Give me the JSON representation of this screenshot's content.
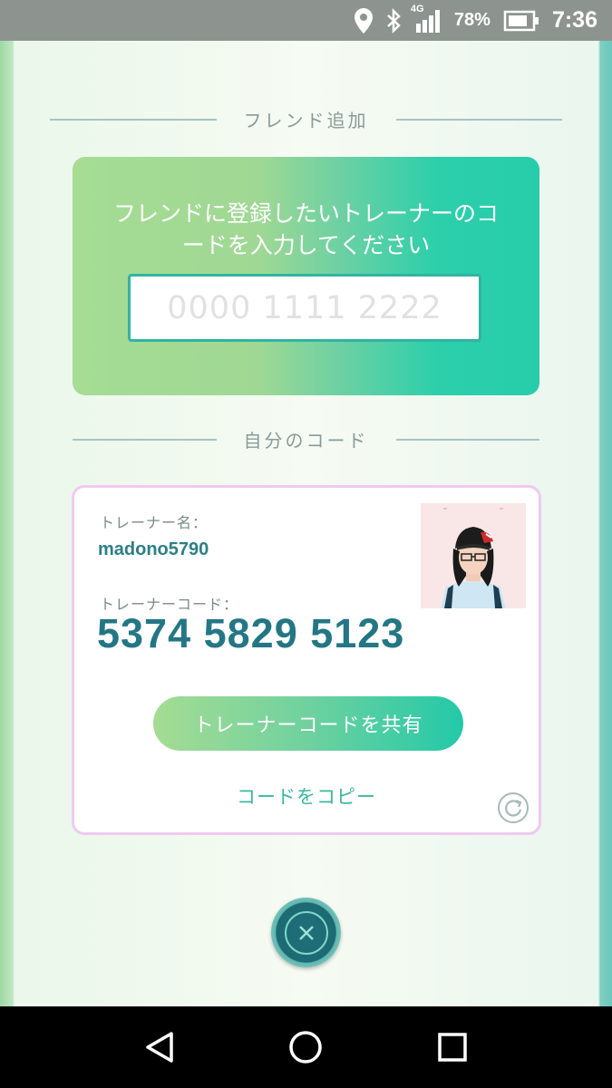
{
  "status_bar": {
    "network": "4G",
    "battery_pct": "78%",
    "time": "7:36"
  },
  "friend_add": {
    "section_title": "フレンド追加",
    "prompt": "フレンドに登録したいトレーナーのコードを入力してください",
    "input": {
      "value": "",
      "placeholder": "0000 1111 2222"
    }
  },
  "my_code": {
    "section_title": "自分のコード",
    "trainer_name_label": "トレーナー名：",
    "trainer_name": "madono5790",
    "trainer_code_label": "トレーナーコード：",
    "trainer_code": "5374 5829 5123",
    "share_button": "トレーナーコードを共有",
    "copy_link": "コードをコピー"
  },
  "colors": {
    "accent": "#27cdaa",
    "code_text": "#237785",
    "card_border": "#efc9f0"
  },
  "icons": [
    "location-icon",
    "bluetooth-icon",
    "signal-icon",
    "battery-icon",
    "refresh-icon",
    "close-icon",
    "back-icon",
    "home-icon",
    "recents-icon"
  ]
}
